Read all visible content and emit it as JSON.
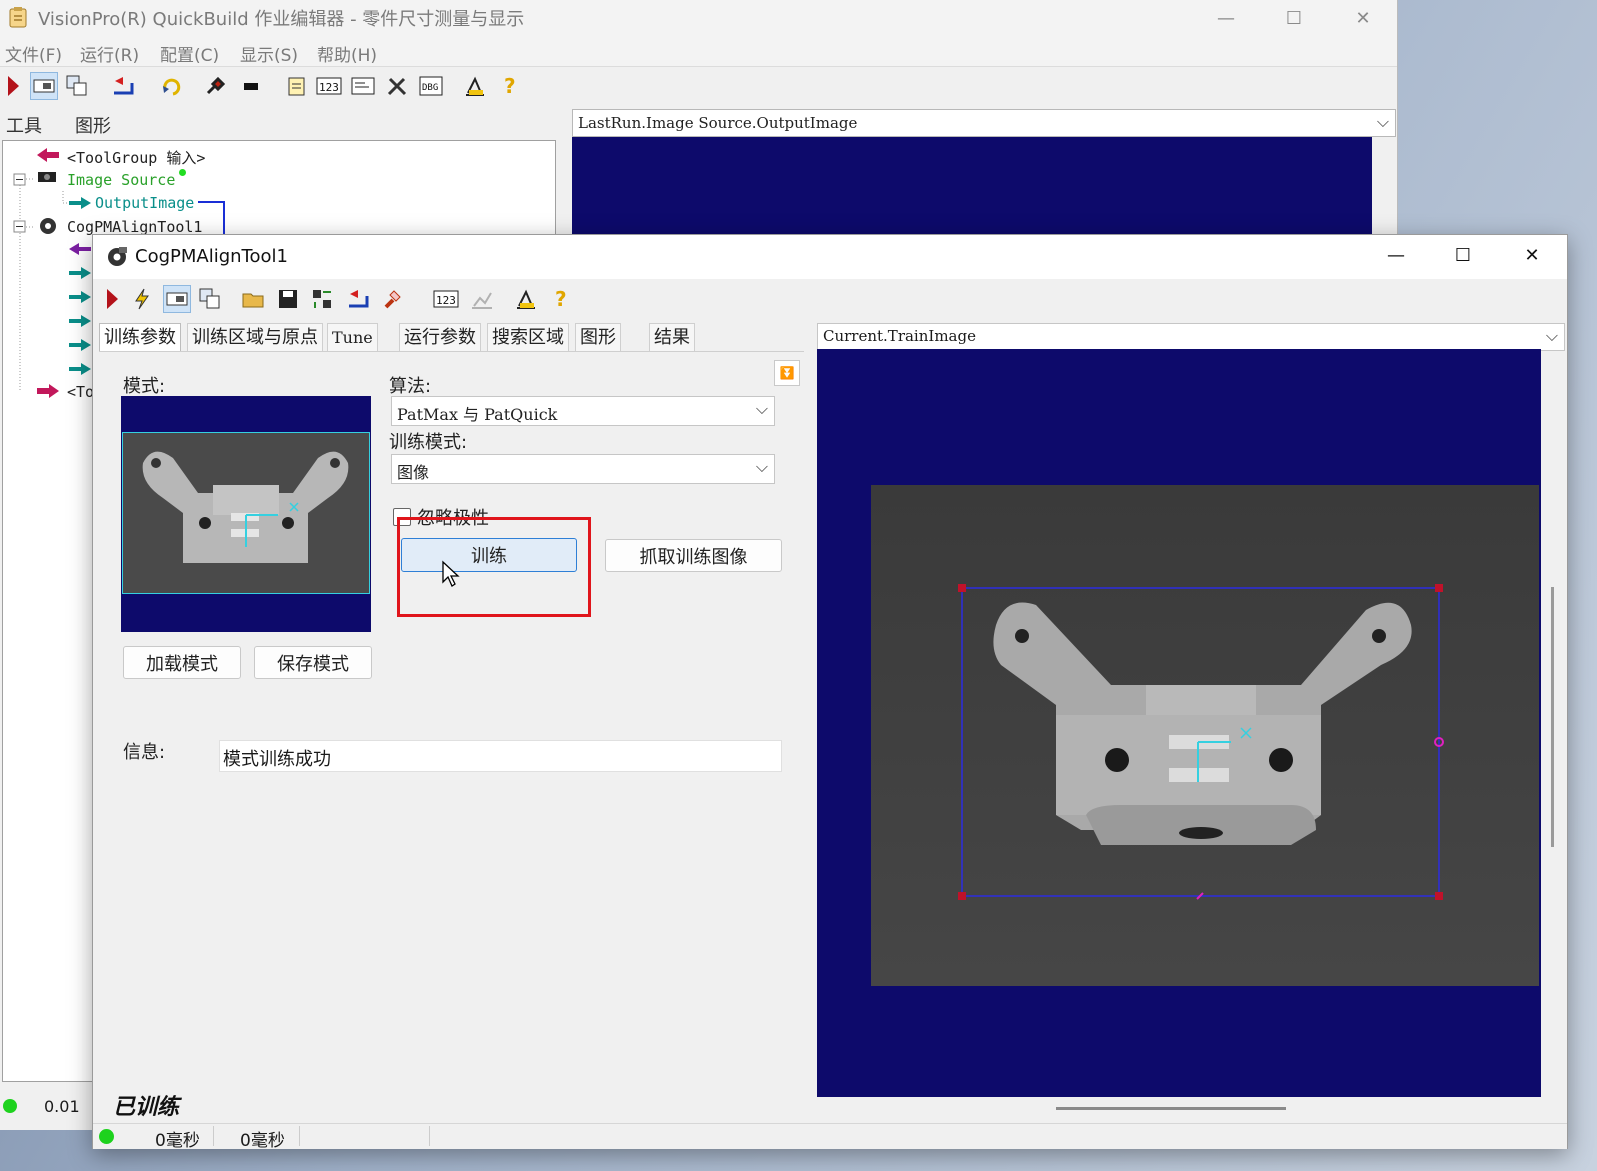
{
  "main_window": {
    "title": "VisionPro(R) QuickBuild 作业编辑器 - 零件尺寸测量与显示",
    "controls": {
      "minimize": "—",
      "maximize": "☐",
      "close": "✕"
    },
    "menu": [
      "文件(F)",
      "运行(R)",
      "配置(C)",
      "显示(S)",
      "帮助(H)"
    ],
    "tabs": [
      "工具",
      "图形"
    ],
    "tree": {
      "toolgroup_input": "<ToolGroup 输入>",
      "image_source": "Image Source",
      "output_image": "OutputImage",
      "pmalign_tool": "CogPMAlignTool1",
      "toolgroup_output_partial": "<To"
    },
    "image_selector": "LastRun.Image Source.OutputImage",
    "status_value": "0.01"
  },
  "dialog": {
    "title": "CogPMAlignTool1",
    "controls": {
      "minimize": "—",
      "maximize": "☐",
      "close": "✕"
    },
    "tabs": [
      "训练参数",
      "训练区域与原点",
      "Tune",
      "运行参数",
      "搜索区域",
      "图形",
      "结果"
    ],
    "pattern_label": "模式:",
    "algorithm_label": "算法:",
    "algorithm_value": "PatMax 与 PatQuick",
    "train_mode_label": "训练模式:",
    "train_mode_value": "图像",
    "ignore_polarity_label": "忽略极性",
    "ignore_polarity_checked": false,
    "train_button": "训练",
    "grab_train_image_button": "抓取训练图像",
    "load_pattern_button": "加载模式",
    "save_pattern_button": "保存模式",
    "info_label": "信息:",
    "info_value": "模式训练成功",
    "trained_status": "已训练",
    "image_selector": "Current.TrainImage",
    "status_times": [
      "0毫秒",
      "0毫秒"
    ],
    "highlight_color": "#e0151b",
    "display_bg_color": "#0d0a6b"
  }
}
